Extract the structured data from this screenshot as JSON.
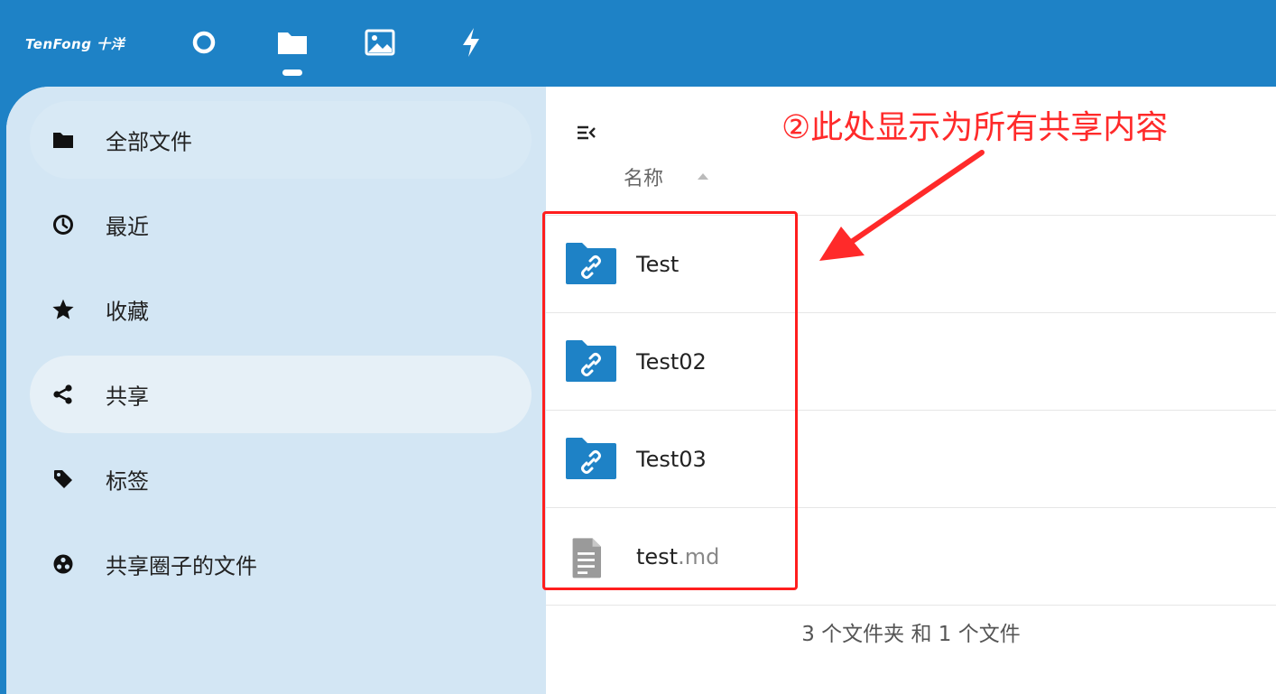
{
  "header": {
    "logo_text": "TenFong 十洋",
    "apps": [
      {
        "name": "dashboard",
        "icon": "circle-icon"
      },
      {
        "name": "files",
        "icon": "folder-icon",
        "active": true
      },
      {
        "name": "photos",
        "icon": "image-icon"
      },
      {
        "name": "activity",
        "icon": "lightning-icon"
      }
    ]
  },
  "sidebar": {
    "items": [
      {
        "label": "全部文件",
        "icon": "folder-icon"
      },
      {
        "label": "最近",
        "icon": "clock-icon"
      },
      {
        "label": "收藏",
        "icon": "star-icon"
      },
      {
        "label": "共享",
        "icon": "share-icon",
        "active": true
      },
      {
        "label": "标签",
        "icon": "tag-icon"
      },
      {
        "label": "共享圈子的文件",
        "icon": "circles-icon"
      }
    ]
  },
  "main": {
    "column_header": "名称",
    "files": [
      {
        "name": "Test",
        "ext": "",
        "type": "shared-folder"
      },
      {
        "name": "Test02",
        "ext": "",
        "type": "shared-folder"
      },
      {
        "name": "Test03",
        "ext": "",
        "type": "shared-folder"
      },
      {
        "name": "test",
        "ext": ".md",
        "type": "text-file"
      }
    ],
    "summary": "3 个文件夹 和 1 个文件"
  },
  "annotation": {
    "text": "②此处显示为所有共享内容",
    "color": "#ff2a2a"
  },
  "colors": {
    "brand": "#1e82c6",
    "sidebar_bg": "#d3e6f4",
    "folder": "#1e82c6"
  }
}
